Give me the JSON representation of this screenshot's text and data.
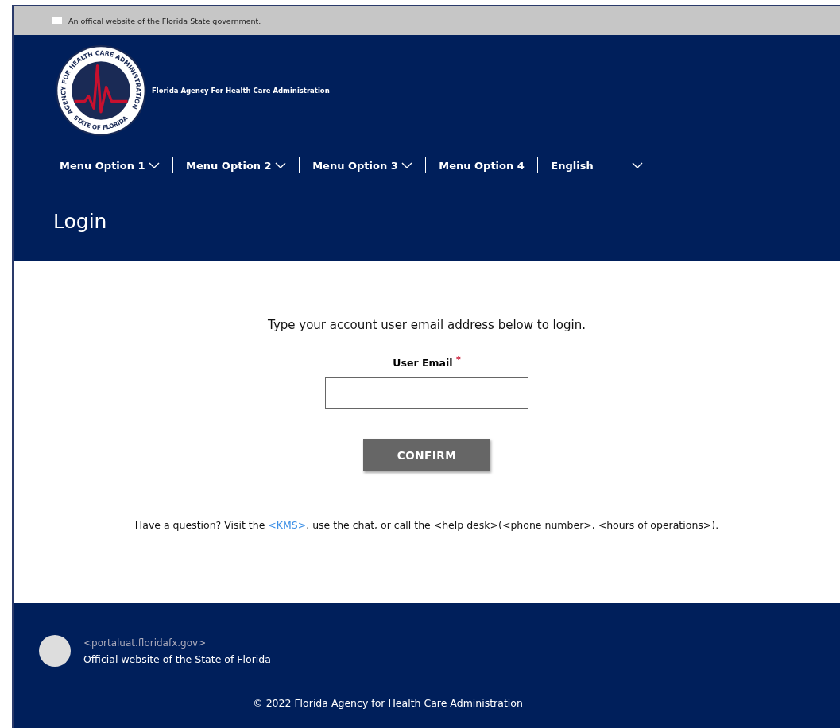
{
  "gov_banner": {
    "text": "An offical website of the Florida State government."
  },
  "header": {
    "logo": {
      "ring_top": "AGENCY FOR HEALTH CARE ADMINISTRATION",
      "ring_bottom": "STATE OF FLORIDA"
    },
    "agency_name": "Florida Agency For Health Care Administration"
  },
  "nav": [
    {
      "label": "Menu Option 1",
      "dropdown": true,
      "kind": "menu"
    },
    {
      "label": "Menu Option 2",
      "dropdown": true,
      "kind": "menu"
    },
    {
      "label": "Menu Option 3",
      "dropdown": true,
      "kind": "menu"
    },
    {
      "label": "Menu Option 4",
      "dropdown": false,
      "kind": "menu"
    },
    {
      "label": "English",
      "dropdown": true,
      "kind": "language"
    }
  ],
  "page_title": "Login",
  "form": {
    "instruction": "Type your account user email address below to login.",
    "field_label": "User Email $^{*}$",
    "button": "CONFIRM"
  },
  "help": {
    "before": "Have a question? Visit the ",
    "link": "<KMS>",
    "after": ", use the chat, or call the <help desk>(<phone number>, <hours of operations>)."
  },
  "footer": {
    "domain": "<portaluat.floridafx.gov>",
    "official": "Official website of the State of Florida",
    "copyright": "© 2022 Florida Agency for Health Care Administration"
  }
}
